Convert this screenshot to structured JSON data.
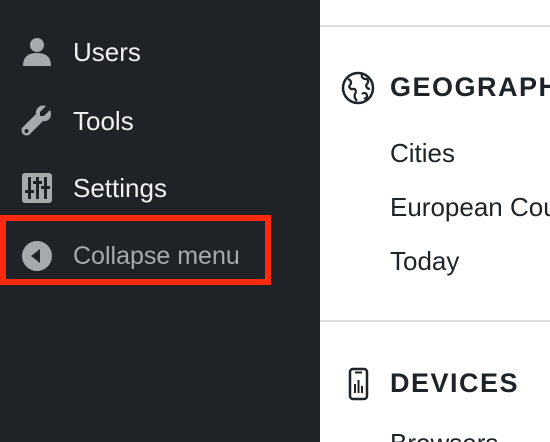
{
  "sidebar": {
    "items": [
      {
        "label": "Users",
        "icon": "user-icon"
      },
      {
        "label": "Tools",
        "icon": "wrench-icon"
      },
      {
        "label": "Settings",
        "icon": "sliders-icon"
      }
    ],
    "collapse_label": "Collapse menu",
    "collapse_icon": "arrow-left-circle-icon",
    "highlight_color": "#ff2a0e"
  },
  "main": {
    "sections": [
      {
        "title": "GEOGRAPHY",
        "icon": "globe-icon",
        "links": [
          "Cities",
          "European Countries",
          "Today"
        ]
      },
      {
        "title": "DEVICES",
        "icon": "smartphone-icon",
        "links": [
          "Browsers"
        ]
      }
    ]
  },
  "colors": {
    "sidebar_bg": "#1f2328",
    "sidebar_text": "#f0f0f1",
    "sidebar_muted": "#a7aaad",
    "icon_gray": "#a7aaad"
  }
}
